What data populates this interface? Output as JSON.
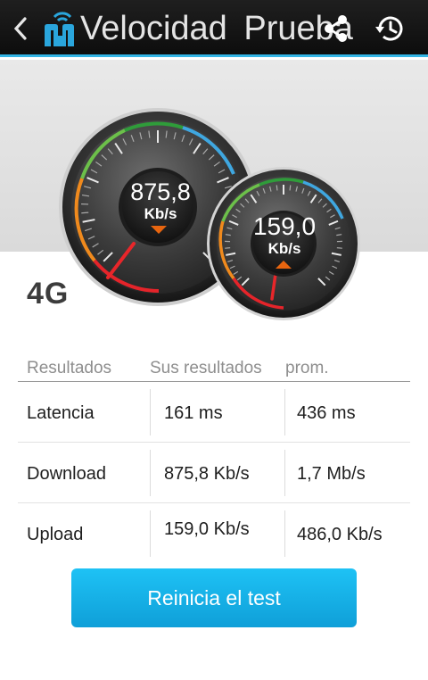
{
  "toolbar": {
    "title": "Velocidad  Prueba",
    "back_icon": "chevron-left-icon",
    "logo_icon": "app-logo-icon",
    "share_icon": "share-icon",
    "history_icon": "history-icon"
  },
  "gauges": {
    "download": {
      "value": "875,8",
      "unit": "Kb/s",
      "direction_icon": "arrow-down-icon",
      "arrow_color": "#e8650f"
    },
    "upload": {
      "value": "159,0",
      "unit": "Kb/s",
      "direction_icon": "arrow-up-icon",
      "arrow_color": "#e8650f"
    },
    "network_type": "4G"
  },
  "results": {
    "headers": [
      "Resultados",
      "Sus resultados",
      "prom."
    ],
    "rows": [
      {
        "label": "Latencia",
        "yours": "161 ms",
        "average": "436 ms"
      },
      {
        "label": "Download",
        "yours": "875,8 Kb/s",
        "average": "1,7 Mb/s"
      },
      {
        "label": "Upload",
        "yours": "159,0 Kb/s",
        "average": "486,0 Kb/s"
      }
    ]
  },
  "restart_label": "Reinicia el test",
  "colors": {
    "actionbar": "#111111",
    "accent": "#33b5e5",
    "button": "#14b0e8",
    "needle": "#e8262a"
  }
}
